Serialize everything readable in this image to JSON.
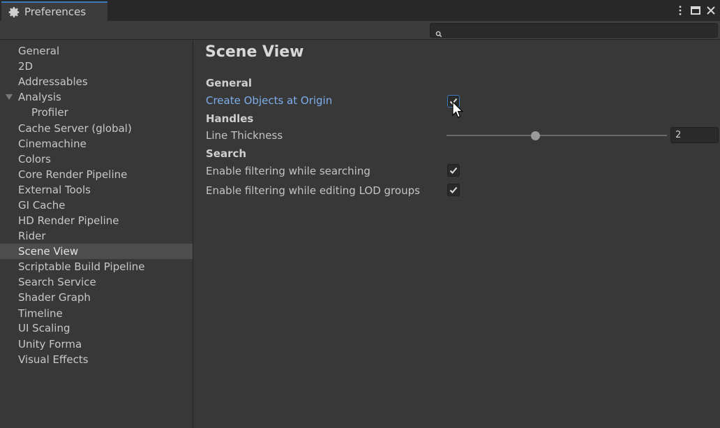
{
  "window": {
    "tab_title": "Preferences",
    "tab_icon": "gear-icon"
  },
  "search": {
    "value": "",
    "placeholder": ""
  },
  "sidebar": {
    "items": [
      {
        "label": "General"
      },
      {
        "label": "2D"
      },
      {
        "label": "Addressables"
      },
      {
        "label": "Analysis",
        "expanded": true
      },
      {
        "label": "Profiler",
        "indent": 1
      },
      {
        "label": "Cache Server (global)"
      },
      {
        "label": "Cinemachine"
      },
      {
        "label": "Colors"
      },
      {
        "label": "Core Render Pipeline"
      },
      {
        "label": "External Tools"
      },
      {
        "label": "GI Cache"
      },
      {
        "label": "HD Render Pipeline"
      },
      {
        "label": "Rider"
      },
      {
        "label": "Scene View",
        "selected": true
      },
      {
        "label": "Scriptable Build Pipeline"
      },
      {
        "label": "Search Service"
      },
      {
        "label": "Shader Graph"
      },
      {
        "label": "Timeline"
      },
      {
        "label": "UI Scaling"
      },
      {
        "label": "Unity Forma"
      },
      {
        "label": "Visual Effects"
      }
    ]
  },
  "main": {
    "title": "Scene View",
    "sections": {
      "general": "General",
      "handles": "Handles",
      "search": "Search"
    },
    "settings": {
      "create_objects_at_origin": {
        "label": "Create Objects at Origin",
        "checked": true
      },
      "line_thickness": {
        "label": "Line Thickness",
        "value": "2",
        "slider_fraction": 0.39
      },
      "enable_filtering_searching": {
        "label": "Enable filtering while searching",
        "checked": true
      },
      "enable_filtering_lod": {
        "label": "Enable filtering while editing LOD groups",
        "checked": true
      }
    }
  },
  "colors": {
    "accent": "#3a79bb",
    "link_text": "#7fadea",
    "background": "#383838",
    "selected_row": "#4d4d4d"
  }
}
